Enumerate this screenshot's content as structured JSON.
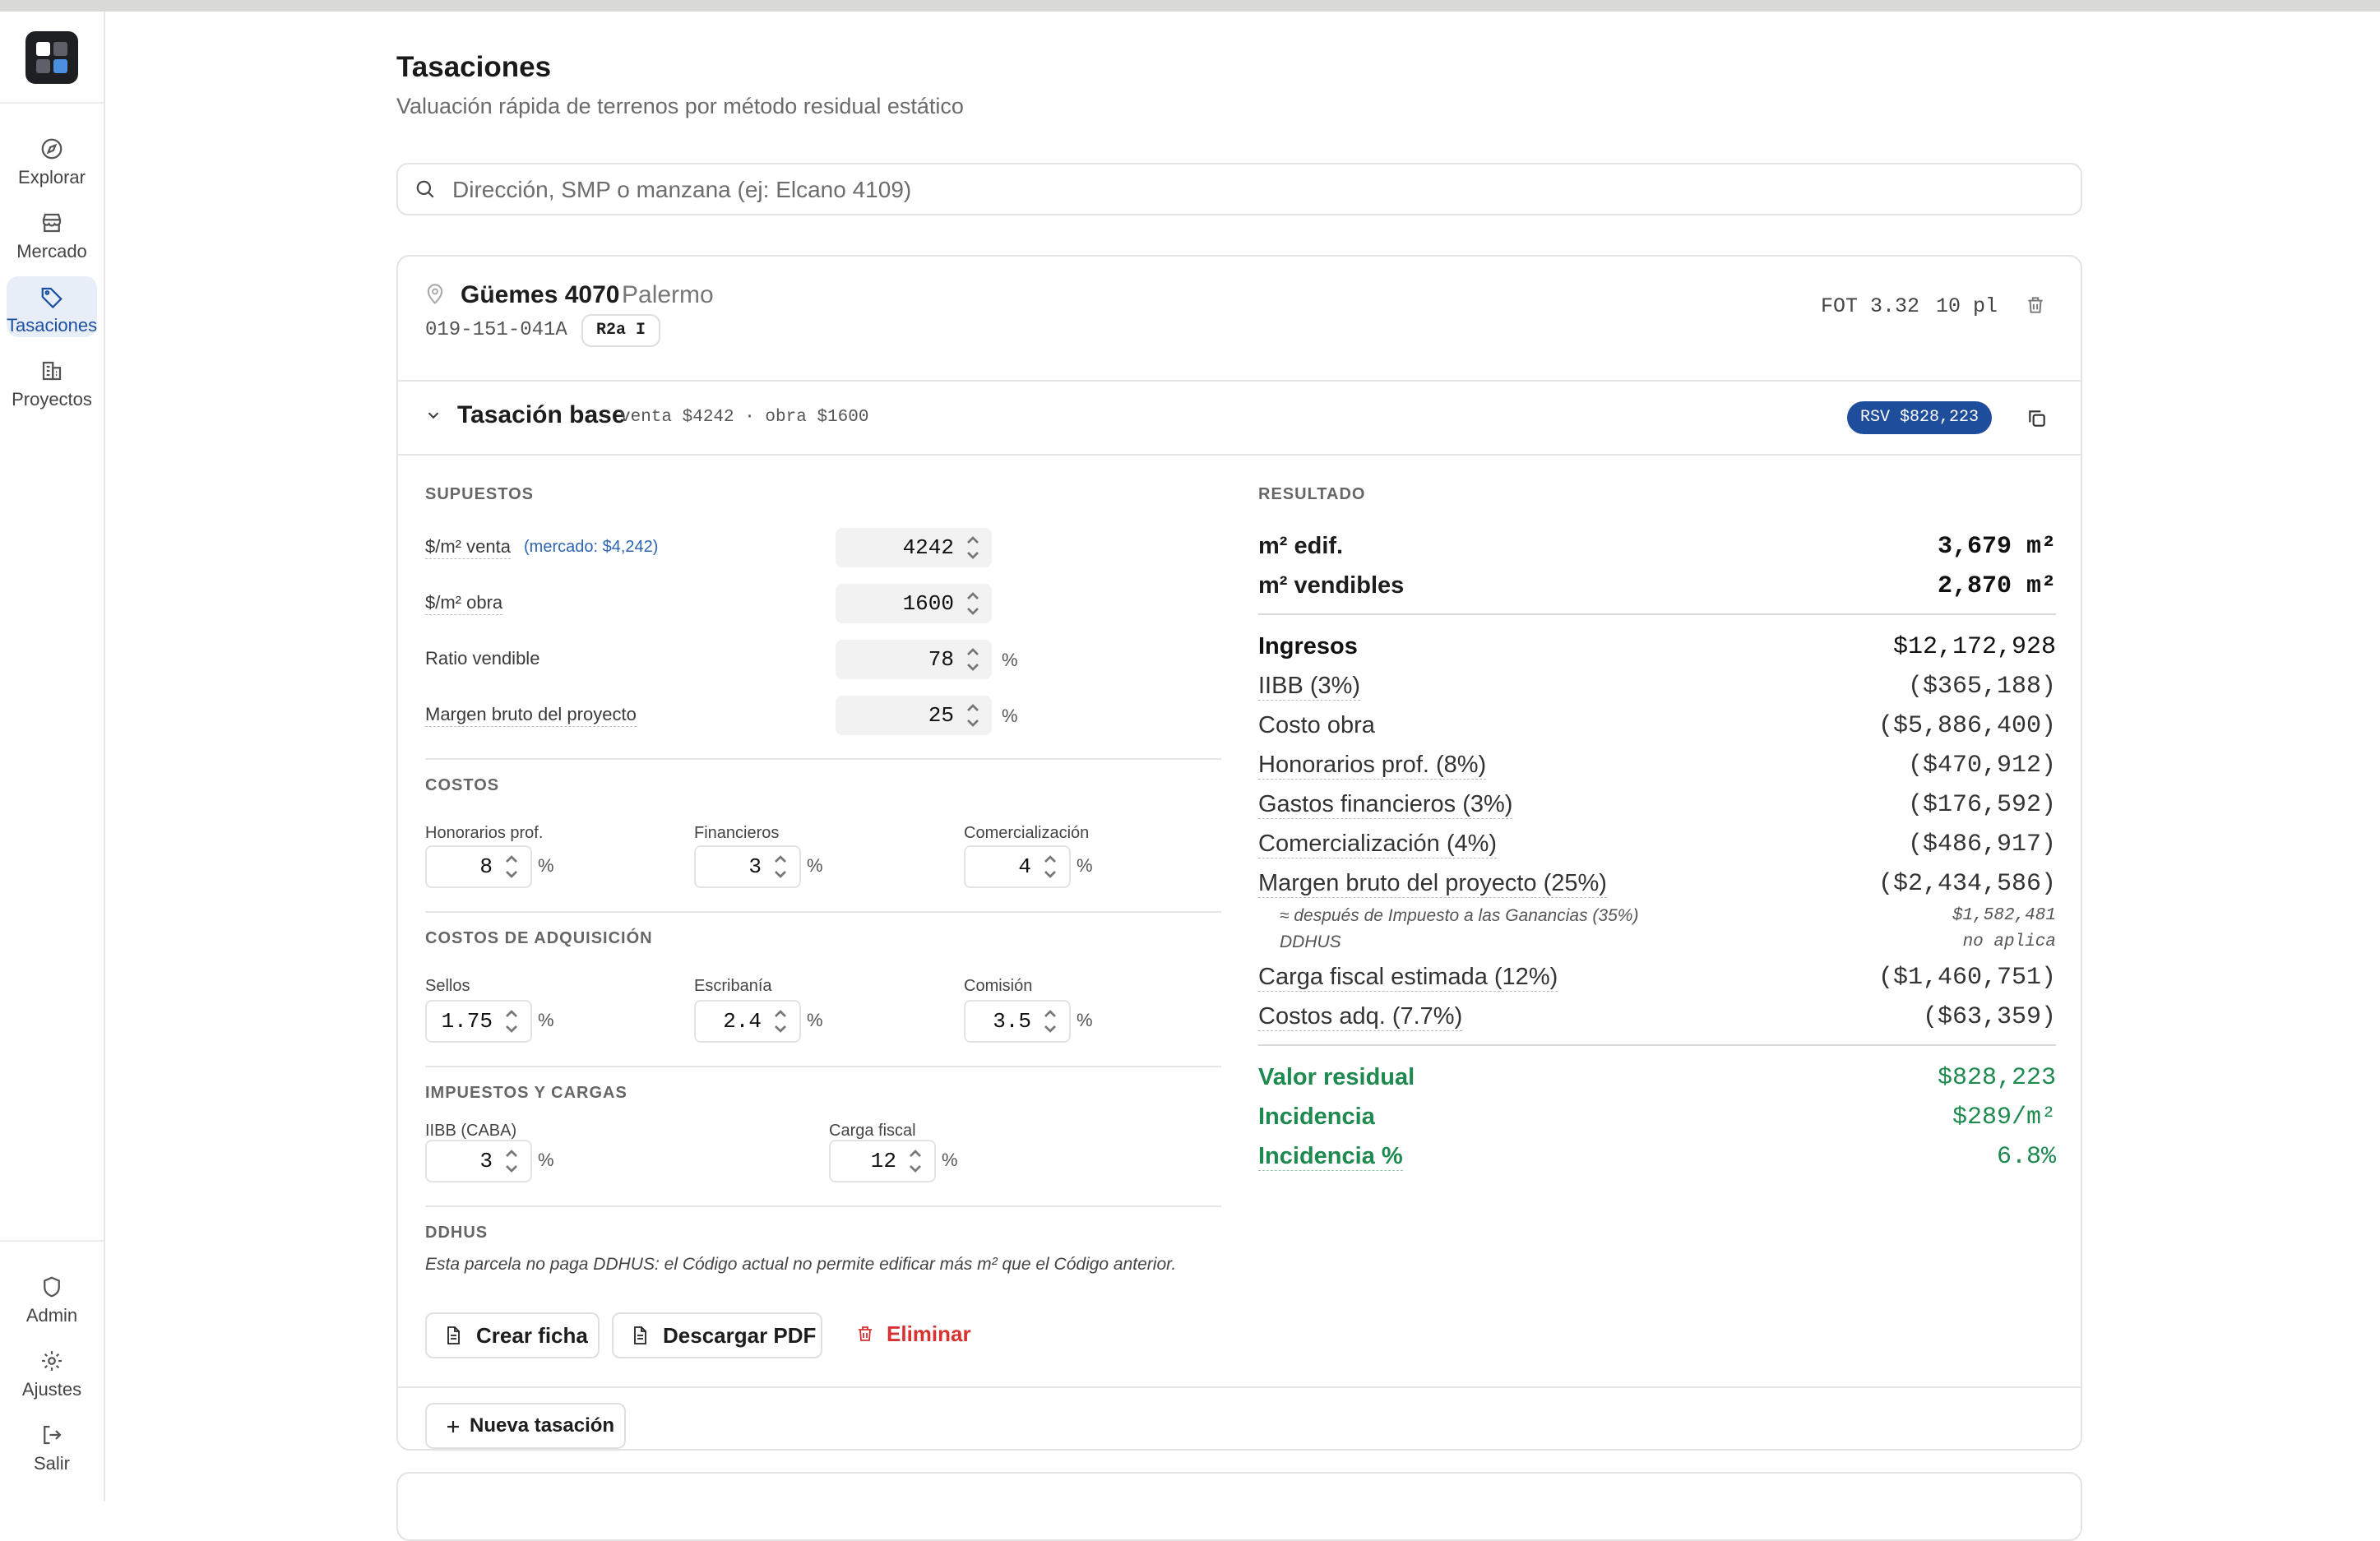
{
  "sidebar": {
    "items": [
      {
        "label": "Explorar",
        "icon": "compass-icon"
      },
      {
        "label": "Mercado",
        "icon": "store-icon"
      },
      {
        "label": "Tasaciones",
        "icon": "tag-icon",
        "active": true
      },
      {
        "label": "Proyectos",
        "icon": "building-icon"
      }
    ],
    "bottom": [
      {
        "label": "Admin",
        "icon": "shield-icon"
      },
      {
        "label": "Ajustes",
        "icon": "gear-icon"
      },
      {
        "label": "Salir",
        "icon": "logout-icon"
      }
    ]
  },
  "page": {
    "title": "Tasaciones",
    "subtitle": "Valuación rápida de terrenos por método residual estático"
  },
  "search": {
    "placeholder": "Dirección, SMP o manzana (ej: Elcano 4109)",
    "value": ""
  },
  "parcel": {
    "address": "Güemes 4070",
    "barrio": "Palermo",
    "smp": "019-151-041A",
    "zone": "R2a I",
    "fot": "FOT 3.32",
    "pisos": "10 pl"
  },
  "tasacion": {
    "title": "Tasación base",
    "meta": "venta $4242 · obra $1600",
    "rsv_badge": "RSV $828,223"
  },
  "supuestos": {
    "heading": "SUPUESTOS",
    "venta_label": "$/m² venta",
    "venta_market": "(mercado: $4,242)",
    "venta": "4242",
    "obra_label": "$/m² obra",
    "obra": "1600",
    "ratio_label": "Ratio vendible",
    "ratio": "78",
    "margen_label": "Margen bruto del proyecto",
    "margen": "25",
    "pct": "%"
  },
  "costos": {
    "heading": "COSTOS",
    "honorarios_label": "Honorarios prof.",
    "honorarios": "8",
    "financieros_label": "Financieros",
    "financieros": "3",
    "comercializacion_label": "Comercialización",
    "comercializacion": "4"
  },
  "adquisicion": {
    "heading": "COSTOS DE ADQUISICIÓN",
    "sellos_label": "Sellos",
    "sellos": "1.75",
    "escribania_label": "Escribanía",
    "escribania": "2.4",
    "comision_label": "Comisión",
    "comision": "3.5"
  },
  "impuestos": {
    "heading": "IMPUESTOS Y CARGAS",
    "iibb_label": "IIBB (CABA)",
    "iibb": "3",
    "carga_label": "Carga fiscal",
    "carga": "12"
  },
  "ddhus": {
    "heading": "DDHUS",
    "text": "Esta parcela no paga DDHUS: el Código actual no permite edificar más m² que el Código anterior."
  },
  "actions": {
    "crear": "Crear ficha",
    "pdf": "Descargar PDF",
    "eliminar": "Eliminar",
    "nueva": "Nueva tasación"
  },
  "resultado": {
    "heading": "RESULTADO",
    "m2_edif_label": "m² edif.",
    "m2_edif": "3,679 m²",
    "m2_vend_label": "m² vendibles",
    "m2_vend": "2,870 m²",
    "rows": [
      {
        "label": "Ingresos",
        "value": "$12,172,928"
      },
      {
        "label": "IIBB (3%)",
        "value": "($365,188)"
      },
      {
        "label": "Costo obra",
        "value": "($5,886,400)"
      },
      {
        "label": "Honorarios prof. (8%)",
        "value": "($470,912)"
      },
      {
        "label": "Gastos financieros (3%)",
        "value": "($176,592)"
      },
      {
        "label": "Comercialización (4%)",
        "value": "($486,917)"
      },
      {
        "label": "Margen bruto del proyecto (25%)",
        "value": "($2,434,586)"
      }
    ],
    "ganancias_note": "≈ después de Impuesto a las Ganancias (35%)",
    "ganancias_value": "$1,582,481",
    "ddhus_note": "DDHUS",
    "ddhus_value": "no aplica",
    "carga_label": "Carga fiscal estimada (12%)",
    "carga_value": "($1,460,751)",
    "adq_label": "Costos adq. (7.7%)",
    "adq_value": "($63,359)",
    "residual_label": "Valor residual",
    "residual_value": "$828,223",
    "incidencia_label": "Incidencia",
    "incidencia_value": "$289/m²",
    "incidencia_pct_label": "Incidencia %",
    "incidencia_pct_value": "6.8%"
  },
  "colors": {
    "accent": "#1e4d9b",
    "positive": "#1f8a4f",
    "danger": "#d93030"
  }
}
